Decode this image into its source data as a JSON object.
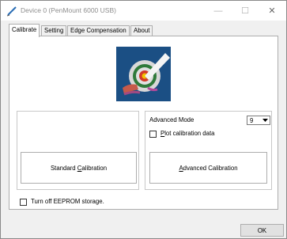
{
  "window": {
    "title": "Device 0 (PenMount 6000 USB)",
    "controls": {
      "minimize": "—",
      "maximize": "☐",
      "close": "✕"
    }
  },
  "tabs": [
    {
      "label": "Calibrate",
      "active": true
    },
    {
      "label": "Setting",
      "active": false
    },
    {
      "label": "Edge Compensation",
      "active": false
    },
    {
      "label": "About",
      "active": false
    }
  ],
  "calibrate": {
    "standard_button": {
      "pre": "Standard ",
      "accel": "C",
      "post": "alibration"
    },
    "advanced_mode_label": "Advanced Mode",
    "advanced_mode_value": "9",
    "plot_checkbox": {
      "accel": "P",
      "post": "lot calibration data",
      "checked": false
    },
    "advanced_button": {
      "accel": "A",
      "post": "dvanced Calibration"
    },
    "eeprom_checkbox": {
      "label": "Turn off EEPROM storage.",
      "checked": false
    }
  },
  "footer": {
    "ok_label": "OK"
  },
  "colors": {
    "logo_bg": "#1b4f84",
    "tab_border": "#adadad",
    "window_bg": "#f0f0f0"
  },
  "icons": {
    "app": "pen-icon",
    "logo": "calibration-target-logo",
    "dropdown": "chevron-down-icon"
  }
}
